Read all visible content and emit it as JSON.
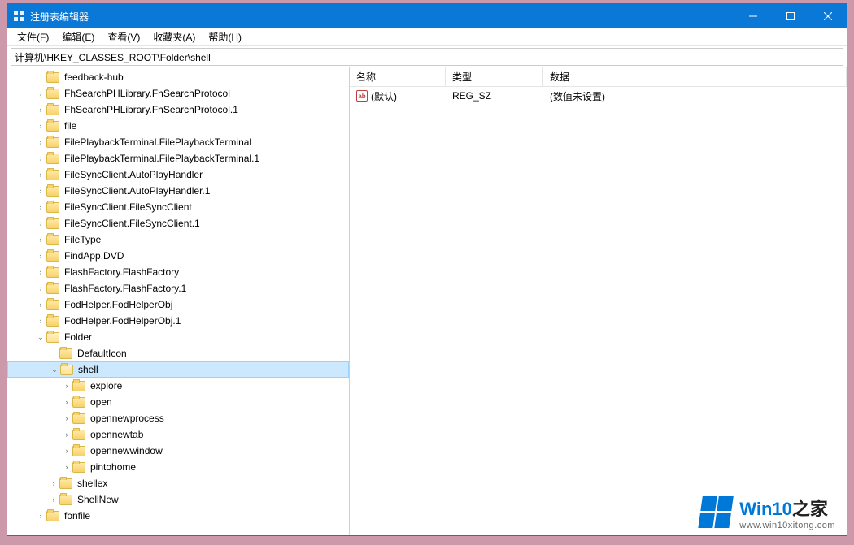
{
  "window": {
    "title": "注册表编辑器"
  },
  "menu": {
    "file": "文件(F)",
    "edit": "编辑(E)",
    "view": "查看(V)",
    "fav": "收藏夹(A)",
    "help": "帮助(H)"
  },
  "address": "计算机\\HKEY_CLASSES_ROOT\\Folder\\shell",
  "columns": {
    "name": "名称",
    "type": "类型",
    "data": "数据"
  },
  "value_row": {
    "name": "(默认)",
    "type": "REG_SZ",
    "data": "(数值未设置)"
  },
  "tree": {
    "level2": [
      "feedback-hub",
      "FhSearchPHLibrary.FhSearchProtocol",
      "FhSearchPHLibrary.FhSearchProtocol.1",
      "file",
      "FilePlaybackTerminal.FilePlaybackTerminal",
      "FilePlaybackTerminal.FilePlaybackTerminal.1",
      "FileSyncClient.AutoPlayHandler",
      "FileSyncClient.AutoPlayHandler.1",
      "FileSyncClient.FileSyncClient",
      "FileSyncClient.FileSyncClient.1",
      "FileType",
      "FindApp.DVD",
      "FlashFactory.FlashFactory",
      "FlashFactory.FlashFactory.1",
      "FodHelper.FodHelperObj",
      "FodHelper.FodHelperObj.1"
    ],
    "folder_node": "Folder",
    "folder_children_before_shell": [
      "DefaultIcon"
    ],
    "shell_node": "shell",
    "shell_children": [
      "explore",
      "open",
      "opennewprocess",
      "opennewtab",
      "opennewwindow",
      "pintohome"
    ],
    "folder_children_after_shell": [
      "shellex",
      "ShellNew"
    ],
    "level2_tail": [
      "fonfile"
    ]
  },
  "watermark": {
    "big_blue": "Win10",
    "big_black": "之家",
    "url": "www.win10xitong.com"
  }
}
